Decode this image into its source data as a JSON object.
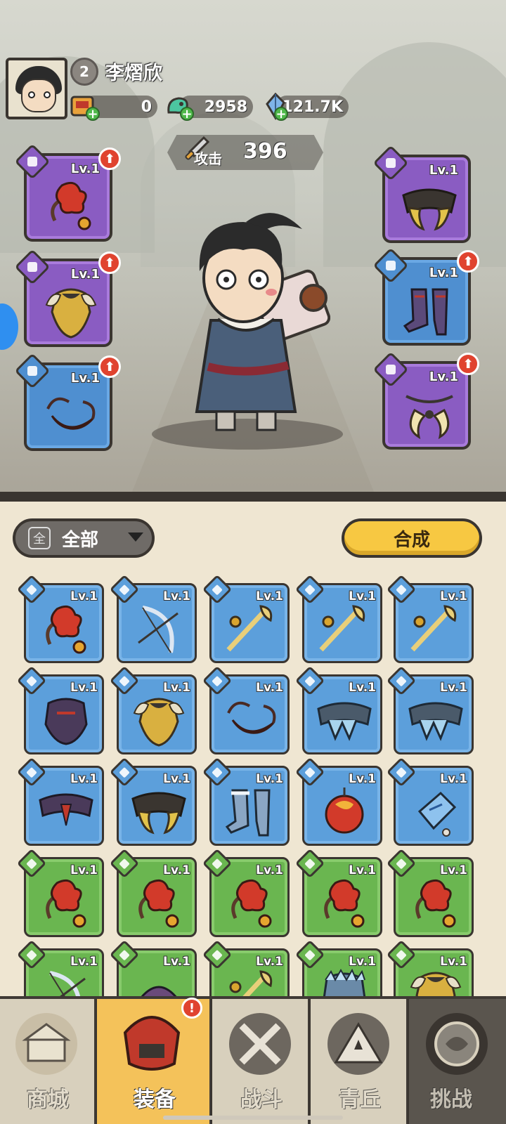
{
  "player": {
    "level": "2",
    "name": "李熠欣"
  },
  "resources": [
    {
      "icon": "scroll-icon",
      "value": "0"
    },
    {
      "icon": "jade-dragon-icon",
      "value": "2958"
    },
    {
      "icon": "crystal-icon",
      "value": "121.7K"
    }
  ],
  "power": {
    "label": "攻击",
    "value": "396"
  },
  "equipped": {
    "left": [
      {
        "slot": "weapon",
        "rarity": "purple",
        "level": "Lv.1",
        "upgrade": true,
        "icon": "flower-weapon-icon"
      },
      {
        "slot": "armor",
        "rarity": "purple",
        "level": "Lv.1",
        "upgrade": true,
        "icon": "golden-armor-icon"
      },
      {
        "slot": "necklace",
        "rarity": "blue",
        "level": "Lv.1",
        "upgrade": true,
        "icon": "red-amulet-icon"
      }
    ],
    "right": [
      {
        "slot": "belt",
        "rarity": "purple",
        "level": "Lv.1",
        "upgrade": false,
        "icon": "claw-belt-icon"
      },
      {
        "slot": "boots",
        "rarity": "blue",
        "level": "Lv.1",
        "upgrade": true,
        "icon": "dark-boots-icon"
      },
      {
        "slot": "ring",
        "rarity": "purple",
        "level": "Lv.1",
        "upgrade": true,
        "icon": "fang-pendant-icon"
      }
    ]
  },
  "filter": {
    "icon_text": "全",
    "label": "全部"
  },
  "craft_button": "合成",
  "inventory": [
    {
      "rarity": "blue",
      "level": "Lv.1",
      "icon": "flower-weapon-icon",
      "slot": "weapon"
    },
    {
      "rarity": "blue",
      "level": "Lv.1",
      "icon": "bow-icon",
      "slot": "weapon"
    },
    {
      "rarity": "blue",
      "level": "Lv.1",
      "icon": "golden-staff-icon",
      "slot": "weapon"
    },
    {
      "rarity": "blue",
      "level": "Lv.1",
      "icon": "golden-staff-icon",
      "slot": "weapon"
    },
    {
      "rarity": "blue",
      "level": "Lv.1",
      "icon": "golden-staff-icon",
      "slot": "weapon"
    },
    {
      "rarity": "blue",
      "level": "Lv.1",
      "icon": "dark-armor-icon",
      "slot": "armor"
    },
    {
      "rarity": "blue",
      "level": "Lv.1",
      "icon": "golden-armor-icon",
      "slot": "armor"
    },
    {
      "rarity": "blue",
      "level": "Lv.1",
      "icon": "red-amulet-icon",
      "slot": "necklace"
    },
    {
      "rarity": "blue",
      "level": "Lv.1",
      "icon": "ice-belt-icon",
      "slot": "belt"
    },
    {
      "rarity": "blue",
      "level": "Lv.1",
      "icon": "ice-belt-icon",
      "slot": "belt"
    },
    {
      "rarity": "blue",
      "level": "Lv.1",
      "icon": "dark-belt-icon",
      "slot": "belt"
    },
    {
      "rarity": "blue",
      "level": "Lv.1",
      "icon": "claw-belt-icon",
      "slot": "belt"
    },
    {
      "rarity": "blue",
      "level": "Lv.1",
      "icon": "ice-boots-icon",
      "slot": "boots"
    },
    {
      "rarity": "blue",
      "level": "Lv.1",
      "icon": "fire-orb-icon",
      "slot": "ring"
    },
    {
      "rarity": "blue",
      "level": "Lv.1",
      "icon": "crystal-charm-icon",
      "slot": "ring"
    },
    {
      "rarity": "green",
      "level": "Lv.1",
      "icon": "flower-weapon-icon",
      "slot": "weapon"
    },
    {
      "rarity": "green",
      "level": "Lv.1",
      "icon": "flower-weapon-icon",
      "slot": "weapon"
    },
    {
      "rarity": "green",
      "level": "Lv.1",
      "icon": "flower-weapon-icon",
      "slot": "weapon"
    },
    {
      "rarity": "green",
      "level": "Lv.1",
      "icon": "flower-weapon-icon",
      "slot": "weapon"
    },
    {
      "rarity": "green",
      "level": "Lv.1",
      "icon": "flower-weapon-icon",
      "slot": "weapon"
    },
    {
      "rarity": "green",
      "level": "Lv.1",
      "icon": "bow-icon",
      "slot": "weapon"
    },
    {
      "rarity": "green",
      "level": "Lv.1",
      "icon": "dark-helm-icon",
      "slot": "weapon"
    },
    {
      "rarity": "green",
      "level": "Lv.1",
      "icon": "golden-staff-icon",
      "slot": "weapon"
    },
    {
      "rarity": "green",
      "level": "Lv.1",
      "icon": "ice-armor-icon",
      "slot": "armor"
    },
    {
      "rarity": "green",
      "level": "Lv.1",
      "icon": "golden-armor-icon",
      "slot": "armor"
    }
  ],
  "nav": [
    {
      "label": "商城",
      "icon": "shop-icon",
      "active": false
    },
    {
      "label": "装备",
      "icon": "equipment-helmet-icon",
      "active": true,
      "alert": "!"
    },
    {
      "label": "战斗",
      "icon": "crossed-swords-icon",
      "active": false
    },
    {
      "label": "青丘",
      "icon": "mountain-icon",
      "active": false
    },
    {
      "label": "挑战",
      "icon": "challenge-orb-icon",
      "active": false
    }
  ],
  "colors": {
    "purple": "#8a5cc2",
    "blue": "#5c9fdb",
    "green": "#6ab650",
    "gold": "#f7c842",
    "outline": "#3a3530"
  }
}
